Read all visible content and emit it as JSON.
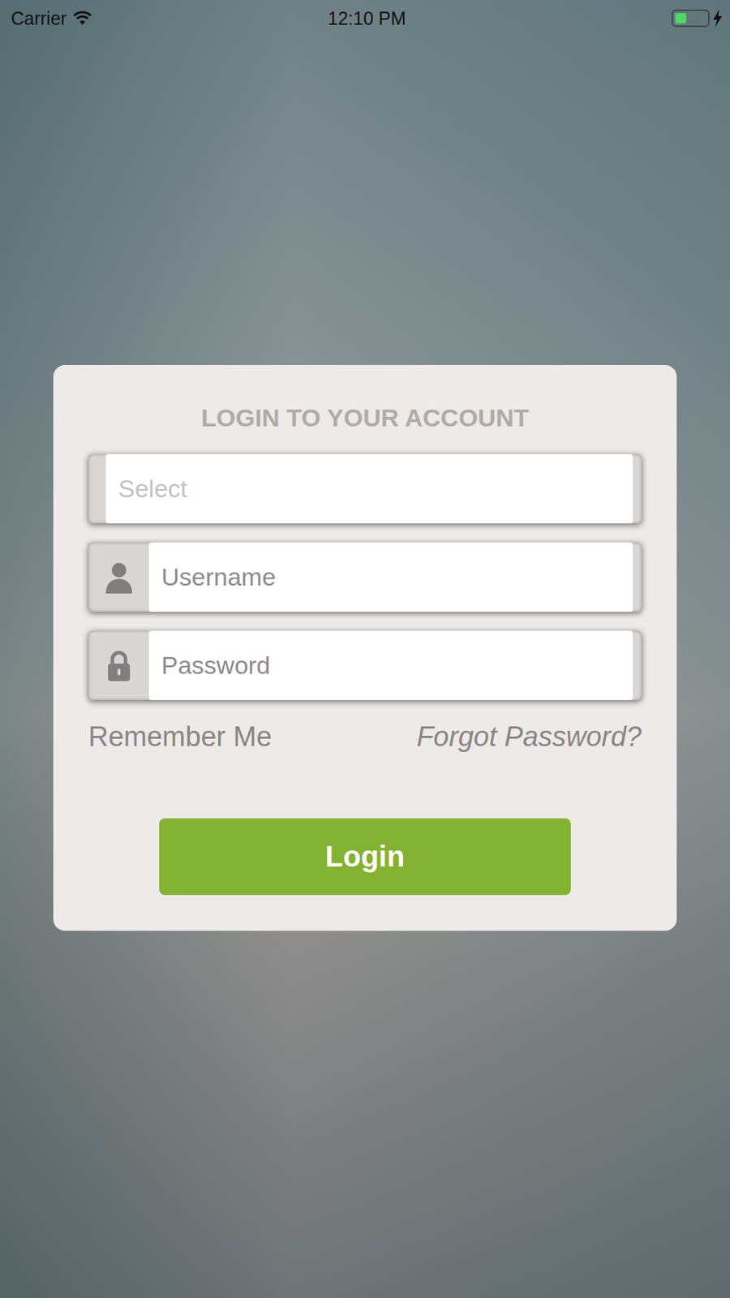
{
  "status_bar": {
    "carrier": "Carrier",
    "time": "12:10 PM",
    "battery_level": 0.35,
    "charging": true
  },
  "login_card": {
    "title": "LOGIN TO YOUR ACCOUNT",
    "fields": [
      {
        "kind": "select",
        "placeholder": "Select"
      },
      {
        "kind": "user",
        "placeholder": "Username"
      },
      {
        "kind": "password",
        "placeholder": "Password"
      }
    ],
    "remember_me": "Remember Me",
    "forgot_password": "Forgot Password?",
    "button": "Login"
  }
}
